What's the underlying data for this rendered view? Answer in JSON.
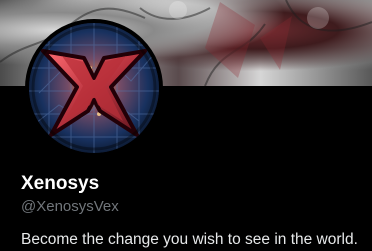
{
  "profile": {
    "display_name": "Xenosys",
    "handle": "@XenosysVex",
    "bio": "Become the change you wish to see in the world."
  },
  "icons": {
    "avatar": "x-emblem-icon"
  },
  "colors": {
    "background": "#000000",
    "primary_text": "#ffffff",
    "secondary_text": "#71767b",
    "bio_text": "#e7e9ea",
    "avatar_accent": "#d6454d"
  }
}
